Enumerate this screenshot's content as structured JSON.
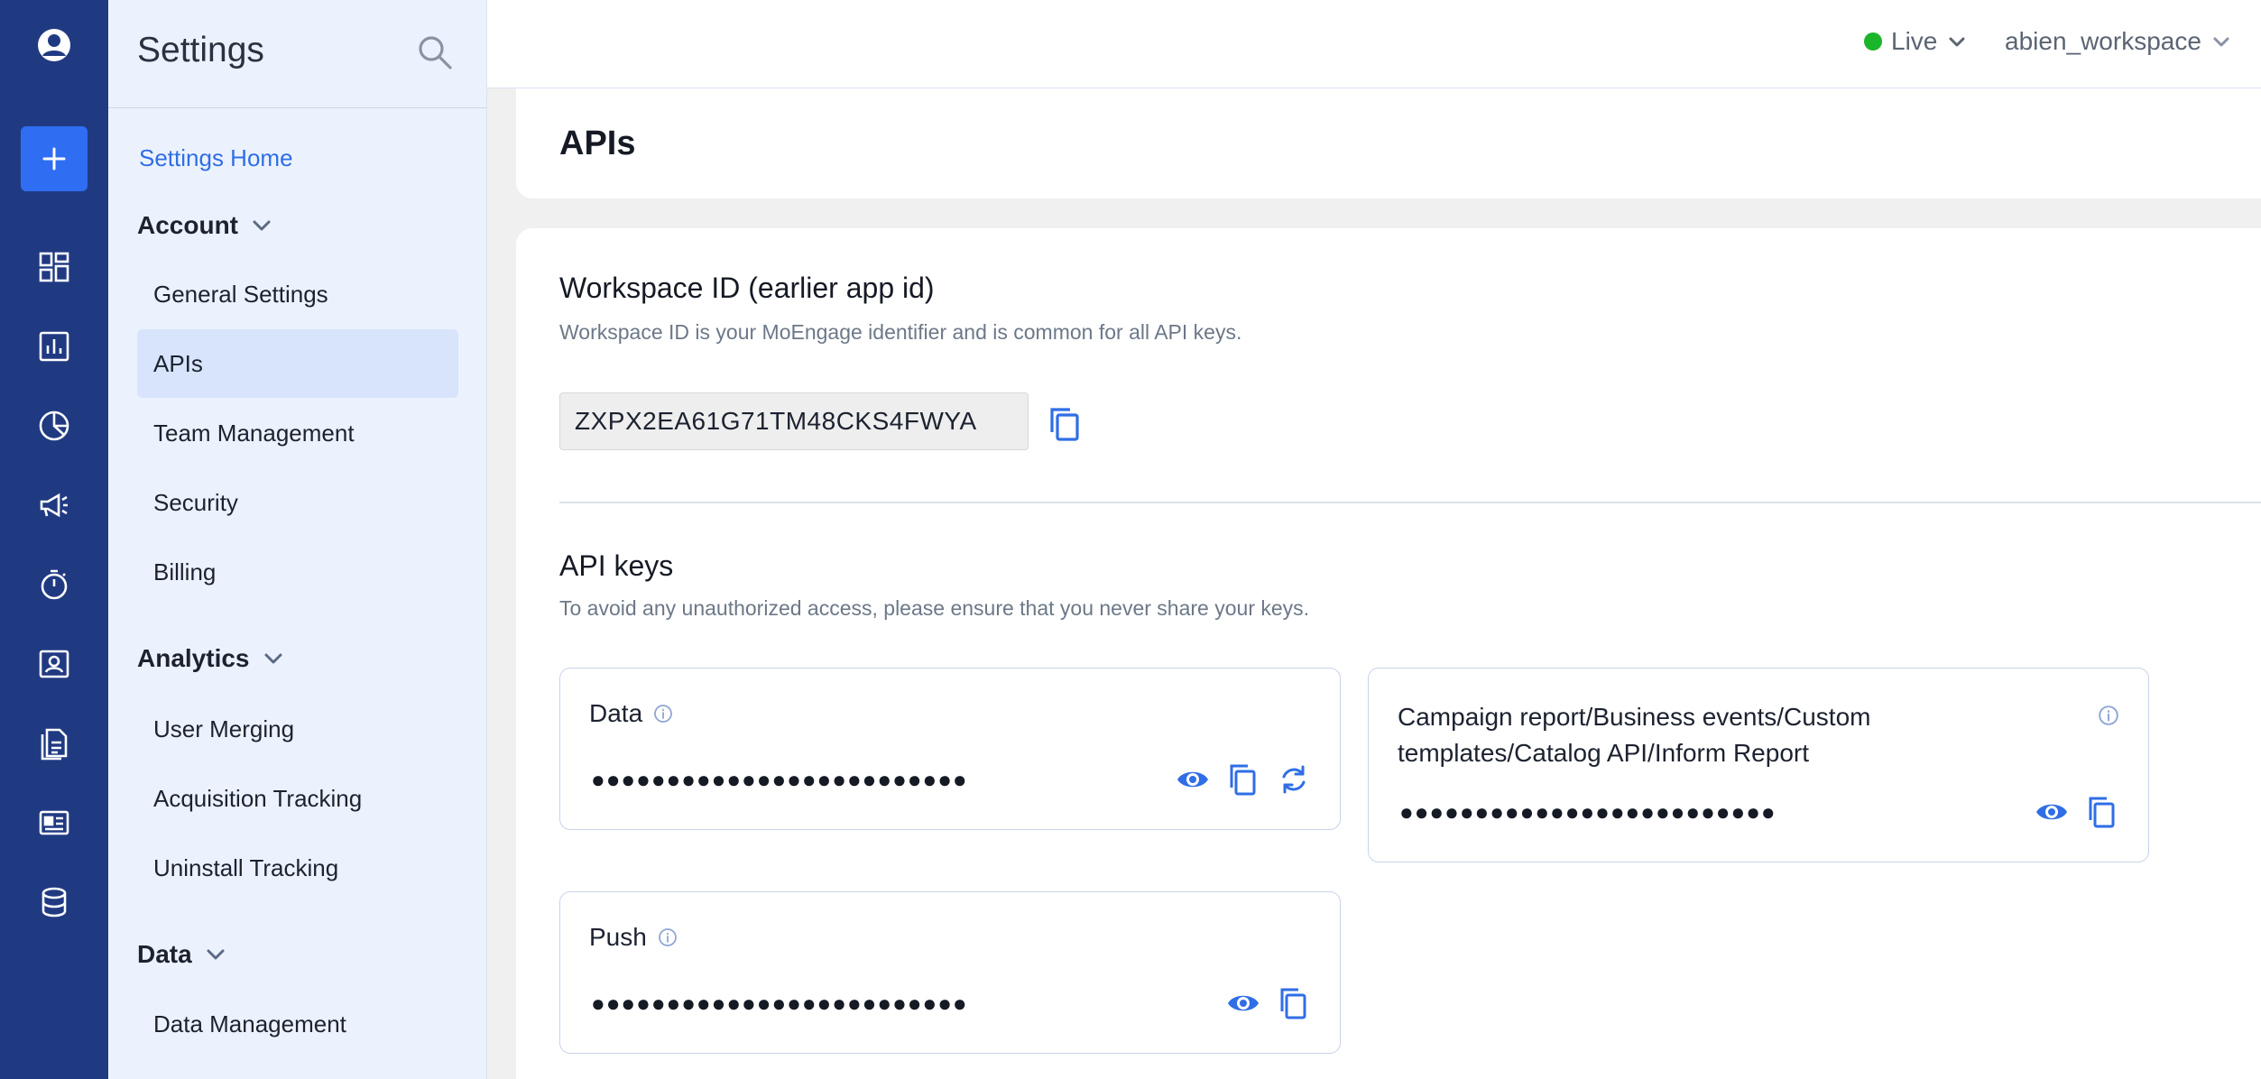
{
  "rail": {
    "items": [
      {
        "name": "profile-icon"
      },
      {
        "name": "add-icon"
      },
      {
        "name": "dashboard-icon"
      },
      {
        "name": "analytics-icon"
      },
      {
        "name": "segments-pie-icon"
      },
      {
        "name": "campaign-megaphone-icon"
      },
      {
        "name": "timer-icon"
      },
      {
        "name": "user-card-icon"
      },
      {
        "name": "documents-icon"
      },
      {
        "name": "content-card-icon"
      },
      {
        "name": "database-icon"
      }
    ]
  },
  "sidebar": {
    "title": "Settings",
    "home_link": "Settings Home",
    "sections": [
      {
        "label": "Account",
        "items": [
          "General Settings",
          "APIs",
          "Team Management",
          "Security",
          "Billing"
        ]
      },
      {
        "label": "Analytics",
        "items": [
          "User Merging",
          "Acquisition Tracking",
          "Uninstall Tracking"
        ]
      },
      {
        "label": "Data",
        "items": [
          "Data Management"
        ]
      }
    ],
    "active_item": "APIs"
  },
  "header": {
    "environment": "Live",
    "workspace": "abien_workspace",
    "status_color": "#1bb52b"
  },
  "page": {
    "title": "APIs"
  },
  "workspace_id": {
    "heading": "Workspace ID (earlier app id)",
    "description": "Workspace ID is your MoEngage identifier and is common for all API keys.",
    "value": "ZXPX2EA61G71TM48CKS4FWYA"
  },
  "api_keys": {
    "heading": "API keys",
    "description": "To avoid any unauthorized access, please ensure that you never share your keys.",
    "cards": [
      {
        "title": "Data",
        "masked": "●●●●●●●●●●●●●●●●●●●●●●●●●"
      },
      {
        "title": "Campaign report/Business events/Custom templates/Catalog API/Inform Report",
        "masked": "●●●●●●●●●●●●●●●●●●●●●●●●●"
      },
      {
        "title": "Push",
        "masked": "●●●●●●●●●●●●●●●●●●●●●●●●●"
      }
    ]
  },
  "colors": {
    "rail_bg": "#203a82",
    "accent": "#2f6ef2",
    "sidebar_bg": "#ecf2fd",
    "active_bg": "#d7e4fb"
  }
}
